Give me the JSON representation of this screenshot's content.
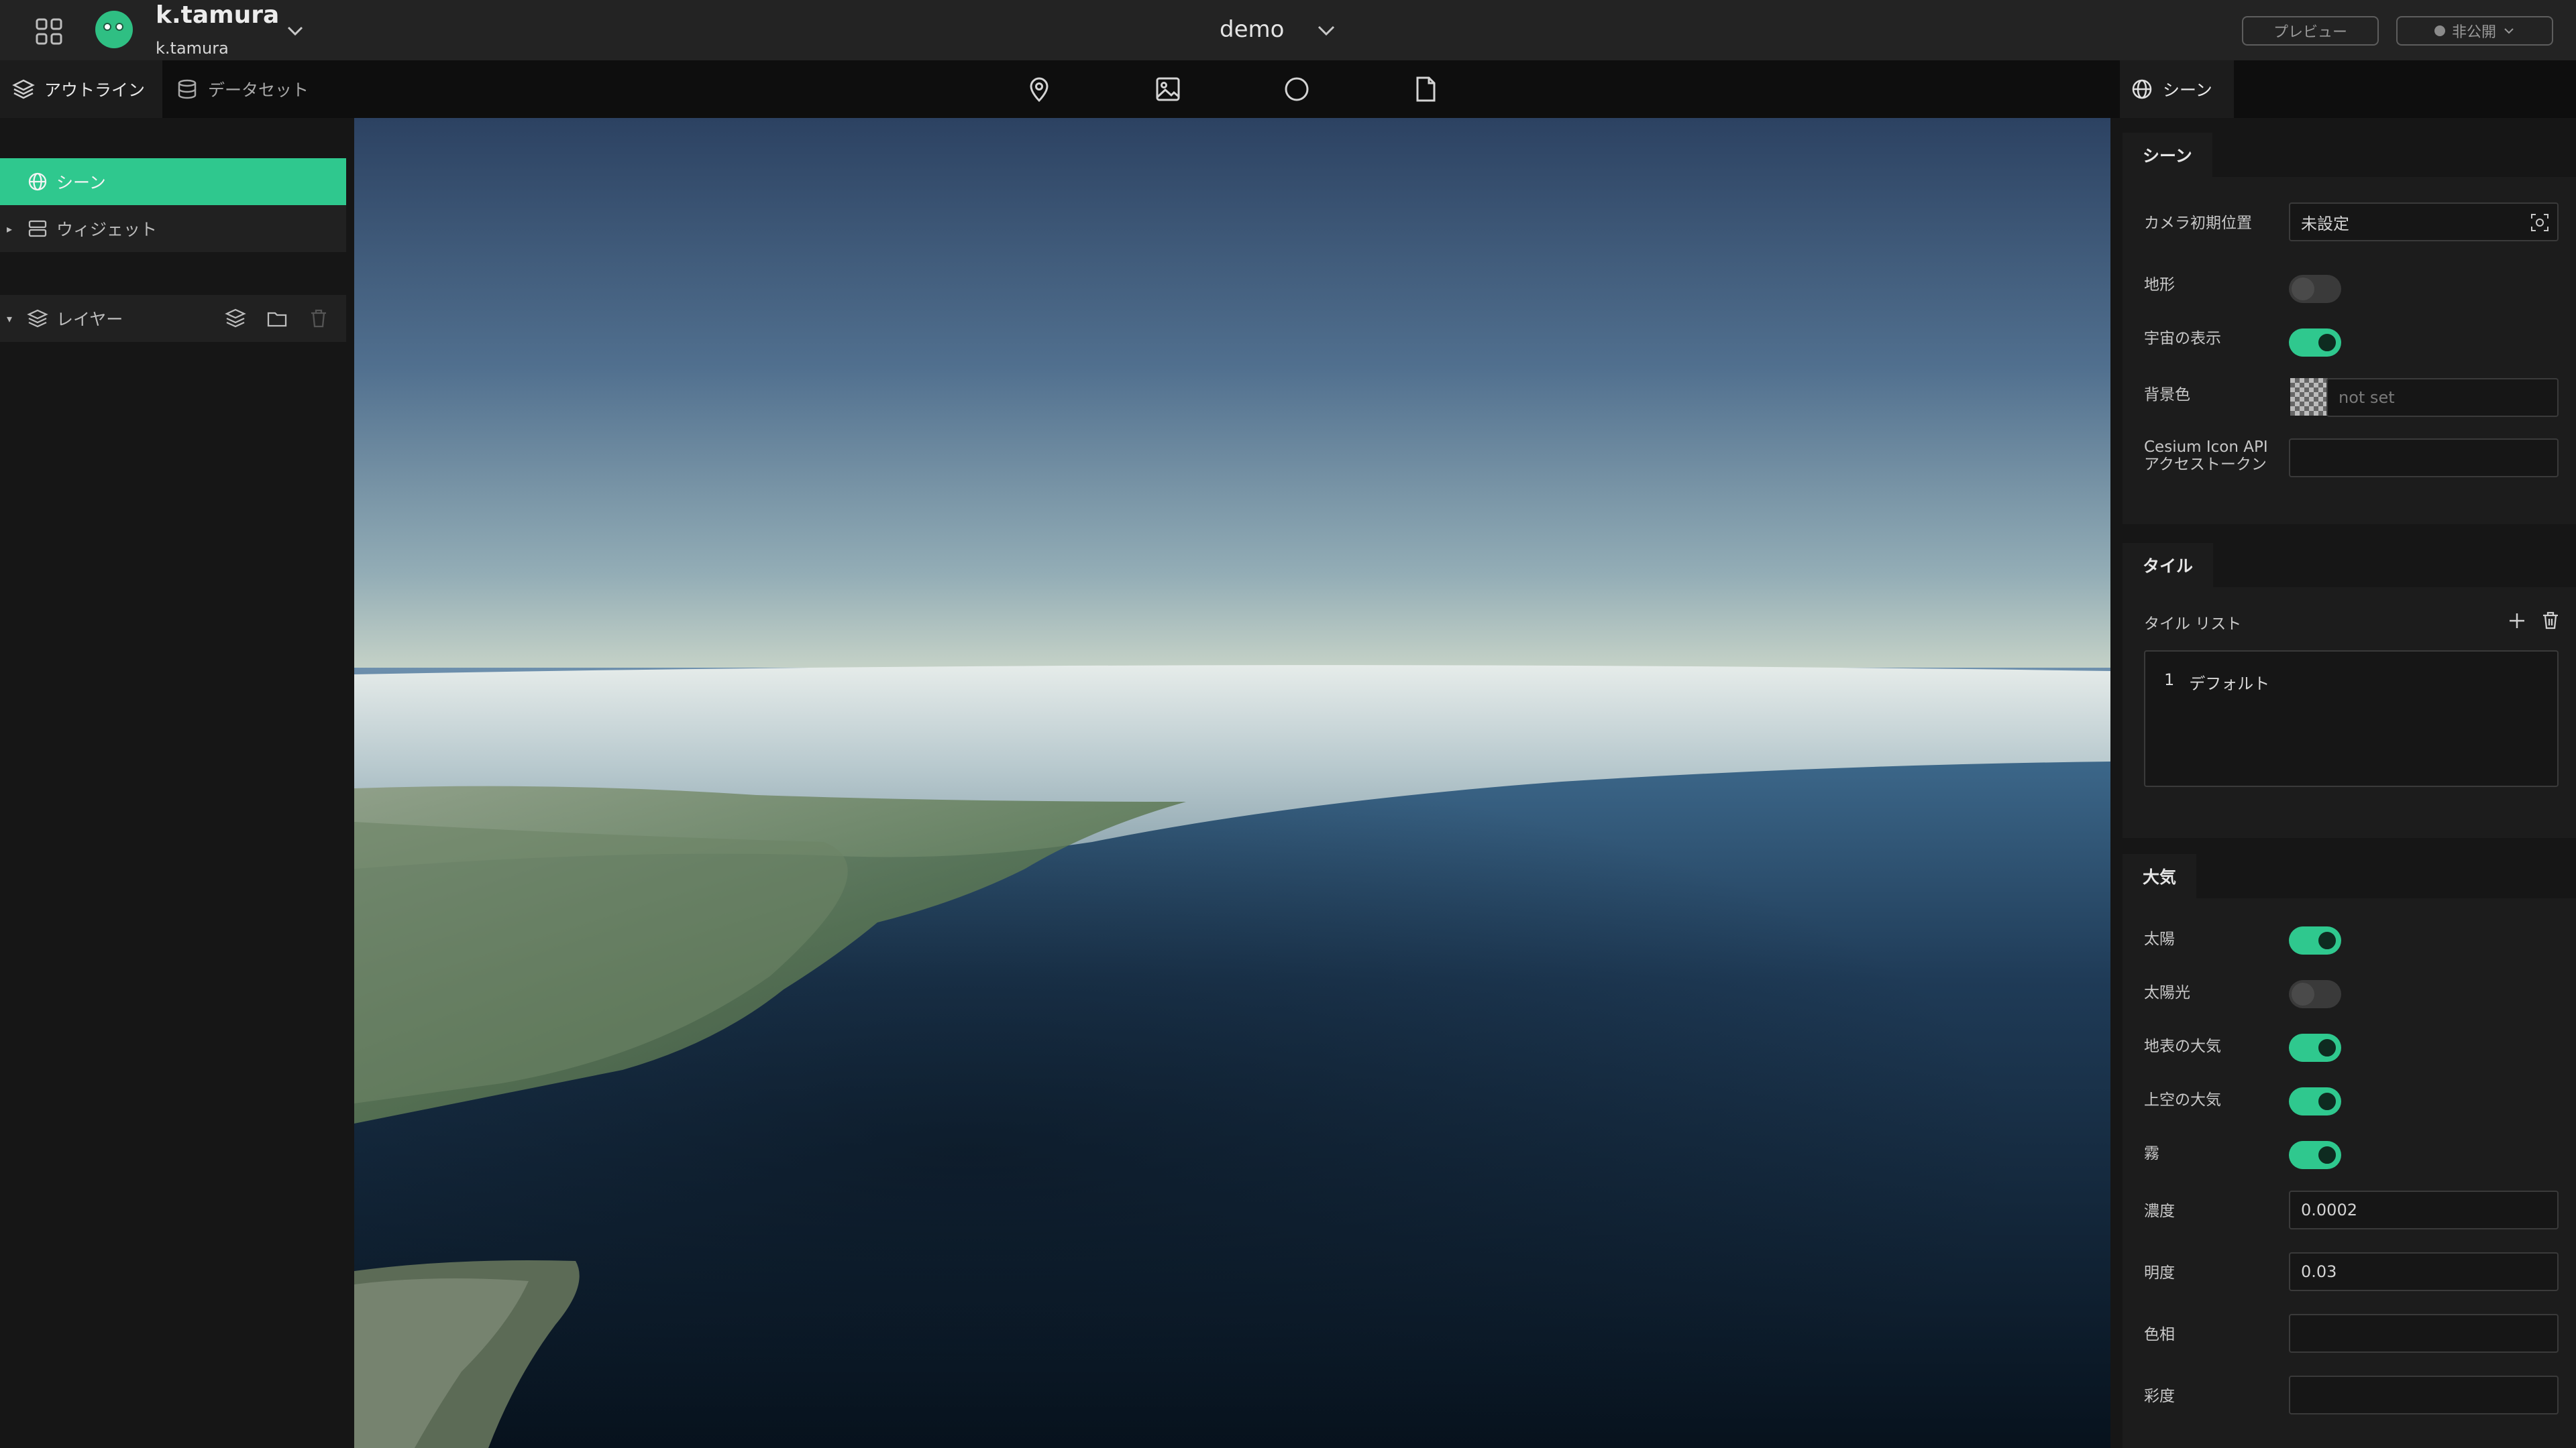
{
  "header": {
    "user_name": "k.tamura",
    "user_sub": "k.tamura",
    "project_name": "demo",
    "preview_label": "プレビュー",
    "publish_label": "非公開"
  },
  "left_tabs": {
    "outline": "アウトライン",
    "dataset": "データセット"
  },
  "toolbar_icons": [
    "map-pin-icon",
    "image-icon",
    "circle-icon",
    "file-icon"
  ],
  "outline": {
    "scene": "シーン",
    "widget": "ウィジェット",
    "layer": "レイヤー"
  },
  "right_tab": "シーン",
  "scene_section": {
    "title": "シーン",
    "camera_label": "カメラ初期位置",
    "camera_value": "未設定",
    "terrain_label": "地形",
    "terrain_on": false,
    "space_label": "宇宙の表示",
    "space_on": true,
    "bg_label": "背景色",
    "bg_placeholder": "not set",
    "token_label_1": "Cesium Icon API",
    "token_label_2": "アクセストークン",
    "token_value": ""
  },
  "tile_section": {
    "title": "タイル",
    "list_label": "タイル リスト",
    "items": [
      {
        "index": "1",
        "name": "デフォルト"
      }
    ]
  },
  "atmosphere_section": {
    "title": "大気",
    "sun_label": "太陽",
    "sun_on": true,
    "sunlight_label": "太陽光",
    "sunlight_on": false,
    "ground_atmo_label": "地表の大気",
    "ground_atmo_on": true,
    "sky_atmo_label": "上空の大気",
    "sky_atmo_on": true,
    "fog_label": "霧",
    "fog_on": true,
    "density_label": "濃度",
    "density_value": "0.0002",
    "brightness_label": "明度",
    "brightness_value": "0.03",
    "hue_label": "色相",
    "hue_value": "",
    "saturation_label": "彩度",
    "saturation_value": ""
  },
  "colors": {
    "accent": "#2fc88e",
    "header_bg": "#232323",
    "panel_bg": "#161616"
  }
}
